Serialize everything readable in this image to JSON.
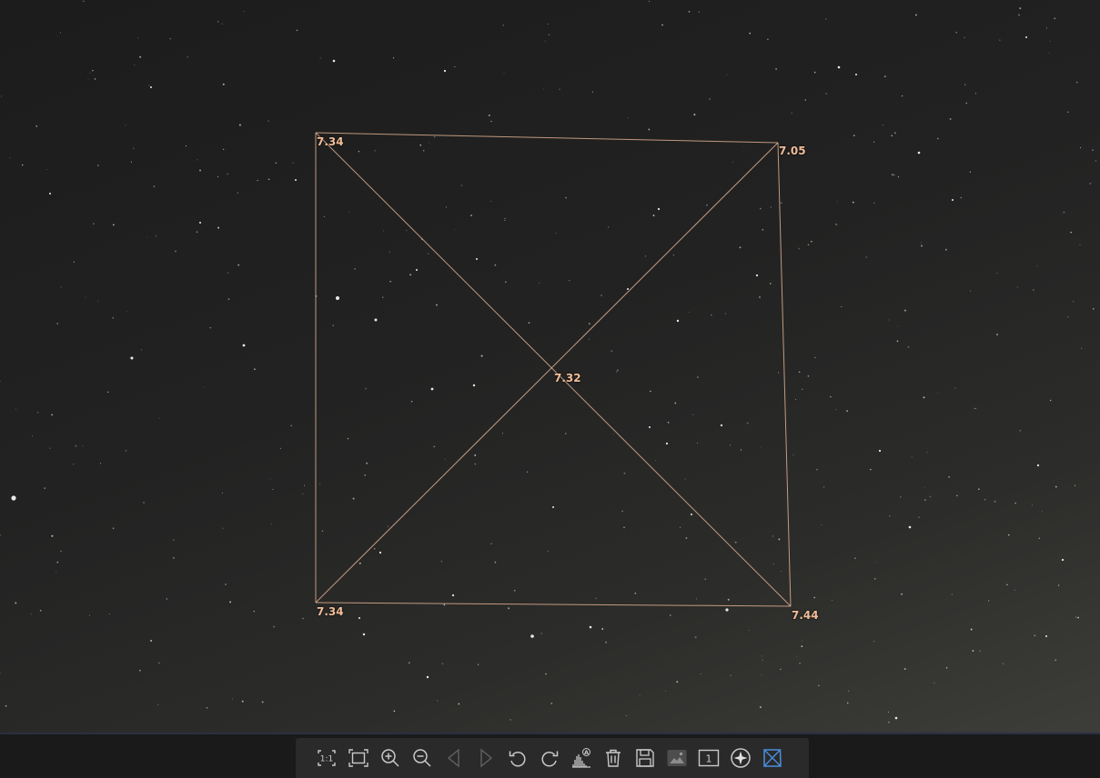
{
  "viewer": {
    "fwhm_values": {
      "top_left": "7.34",
      "top_right": "7.05",
      "center": "7.32",
      "bottom_left": "7.34",
      "bottom_right": "7.44"
    },
    "overlay_color": "#e8b896",
    "label_color": "#f2bd98"
  },
  "toolbar": {
    "buttons": [
      {
        "name": "zoom-1to1-button",
        "icon": "actual-size-icon",
        "glyph": "1:1",
        "enabled": true
      },
      {
        "name": "fit-to-window-button",
        "icon": "fit-screen-icon",
        "enabled": true
      },
      {
        "name": "zoom-in-button",
        "icon": "zoom-in-icon",
        "enabled": true
      },
      {
        "name": "zoom-out-button",
        "icon": "zoom-out-icon",
        "enabled": true
      },
      {
        "name": "previous-image-button",
        "icon": "triangle-left-icon",
        "enabled": false
      },
      {
        "name": "next-image-button",
        "icon": "triangle-right-icon",
        "enabled": false
      },
      {
        "name": "rotate-left-button",
        "icon": "rotate-ccw-icon",
        "enabled": true
      },
      {
        "name": "rotate-right-button",
        "icon": "rotate-cw-icon",
        "enabled": true
      },
      {
        "name": "auto-stretch-histogram-button",
        "icon": "histogram-auto-icon",
        "glyph": "A",
        "enabled": true
      },
      {
        "name": "delete-button",
        "icon": "trash-icon",
        "enabled": true
      },
      {
        "name": "save-button",
        "icon": "floppy-disk-icon",
        "enabled": true
      },
      {
        "name": "background-toggle-button",
        "icon": "landscape-image-icon",
        "enabled": true
      },
      {
        "name": "single-frame-button",
        "icon": "frame-one-icon",
        "glyph": "1",
        "enabled": true
      },
      {
        "name": "star-detection-button",
        "icon": "star-circle-icon",
        "enabled": true
      },
      {
        "name": "tilt-analysis-button",
        "icon": "tilt-square-icon",
        "enabled": true,
        "active": true
      }
    ],
    "icon_color": "#c9c9c9",
    "active_color": "#4a90e2"
  }
}
